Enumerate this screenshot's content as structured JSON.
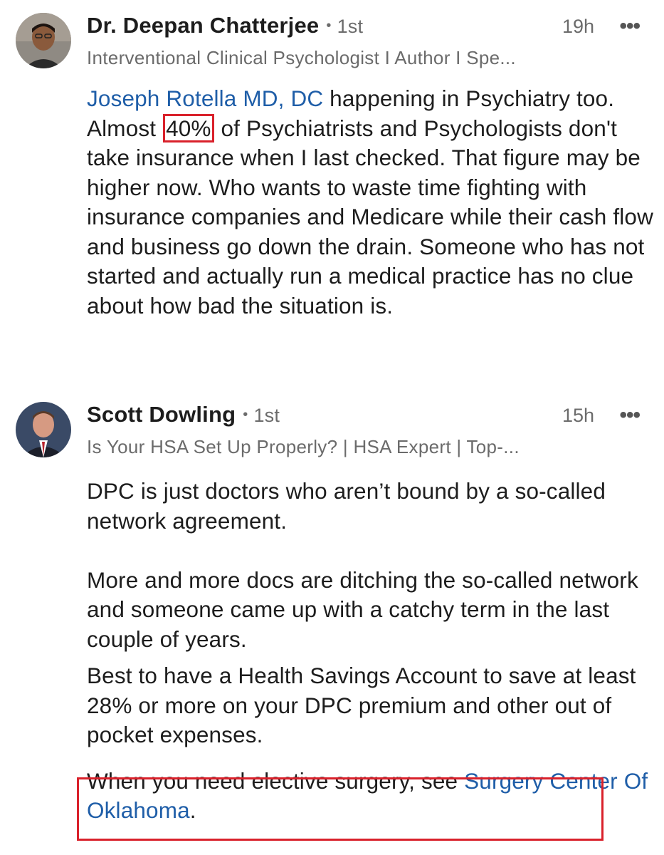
{
  "comments": [
    {
      "author": "Dr. Deepan Chatterjee",
      "degree": "1st",
      "time": "19h",
      "more": "•••",
      "headline": "Interventional Clinical Psychologist I Author I Spe...",
      "mention": "Joseph Rotella MD, DC",
      "text_a": " happening in Psychiatry too. Almost ",
      "highlight": "40%",
      "text_b": " of Psychiatrists and Psychologists don't take insurance when I last checked. That figure may be higher now. Who wants to waste time fighting with insurance companies and Medicare while their cash flow and business go down the drain. Someone who has not started and actually run a medical practice has no clue about how bad the situation is."
    },
    {
      "author": "Scott Dowling",
      "degree": "1st",
      "time": "15h",
      "more": "•••",
      "headline": "Is Your HSA Set Up Properly? | HSA Expert | Top-...",
      "paragraph_1": "DPC is just doctors who aren’t bound by a so-called network agreement.",
      "paragraph_2": "More and more docs are ditching the so-called network and someone came up with a catchy term in the last couple of years.",
      "paragraph_3": "Best to have a Health Savings Account to save at least 28% or more on your DPC premium and other out of pocket expenses.",
      "paragraph_4_text": "When you need elective surgery, see ",
      "paragraph_4_link": "Surgery Center Of Oklahoma",
      "paragraph_4_end": "."
    }
  ],
  "icons": {
    "more": "more-horizontal-icon",
    "degree_separator": "dot-icon"
  },
  "colors": {
    "link": "#1f5ea8",
    "highlight_box": "#d9212b",
    "secondary_text": "#6b6b6b"
  }
}
